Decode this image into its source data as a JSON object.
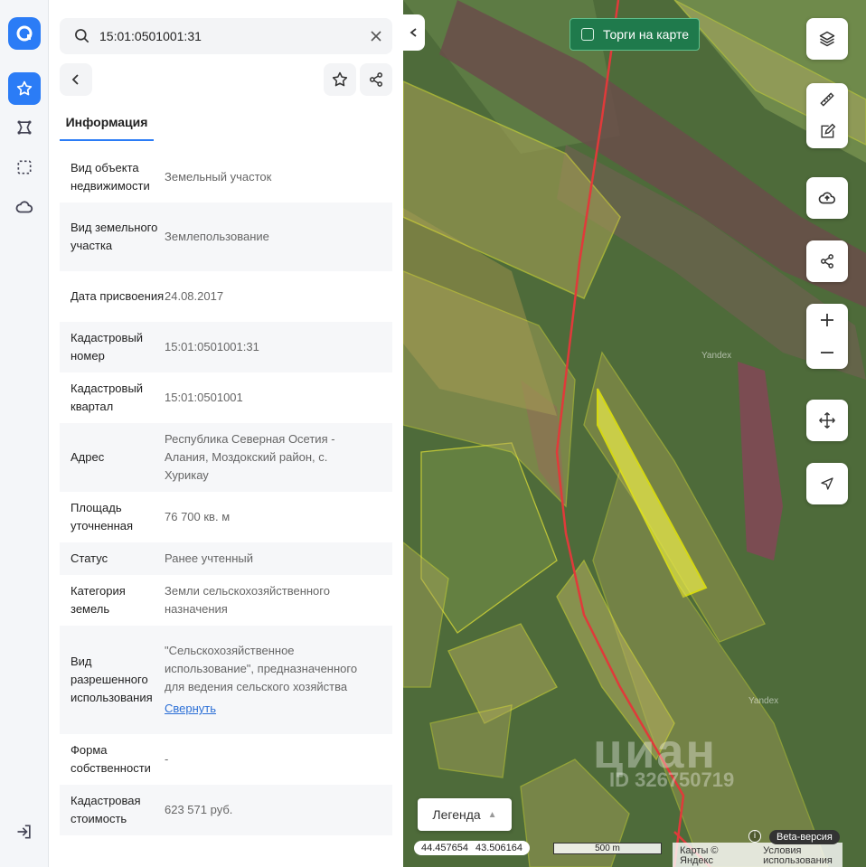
{
  "search": {
    "value": "15:01:0501001:31"
  },
  "tab_label": "Информация",
  "rows": [
    {
      "k": "Вид объекта недвижимости",
      "v": "Земельный участок"
    },
    {
      "k": "Вид земельного участка",
      "v": "Землепользование"
    },
    {
      "k": "Дата присвоения",
      "v": "24.08.2017"
    },
    {
      "k": "Кадастровый номер",
      "v": "15:01:0501001:31"
    },
    {
      "k": "Кадастровый квартал",
      "v": "15:01:0501001"
    },
    {
      "k": "Адрес",
      "v": "Республика Северная Осетия - Алания, Моздокский район, с. Хурикау"
    },
    {
      "k": "Площадь уточненная",
      "v": "76 700 кв. м"
    },
    {
      "k": "Статус",
      "v": "Ранее учтенный"
    },
    {
      "k": "Категория земель",
      "v": "Земли сельскохозяйственного назначения"
    },
    {
      "k": "Вид разрешенного использования",
      "v": "\"Сельскохозяйственное использование\", предназначенного для ведения сельского хозяйства",
      "link": "Свернуть"
    },
    {
      "k": "Форма собственности",
      "v": "-"
    },
    {
      "k": "Кадастровая стоимость",
      "v": "623 571 руб."
    }
  ],
  "map": {
    "torgi_label": "Торги на карте",
    "legend_label": "Легенда",
    "coord_lat": "44.457654",
    "coord_lon": "43.506164",
    "scale_label": "500 m",
    "attrib_maps": "Карты © Яндекс",
    "attrib_terms": "Условия использования",
    "beta_label": "Beta-версия",
    "info_glyph": "i",
    "yandex_label": "Yandex",
    "watermark": "циан",
    "watermark_id": "ID 326750719"
  }
}
